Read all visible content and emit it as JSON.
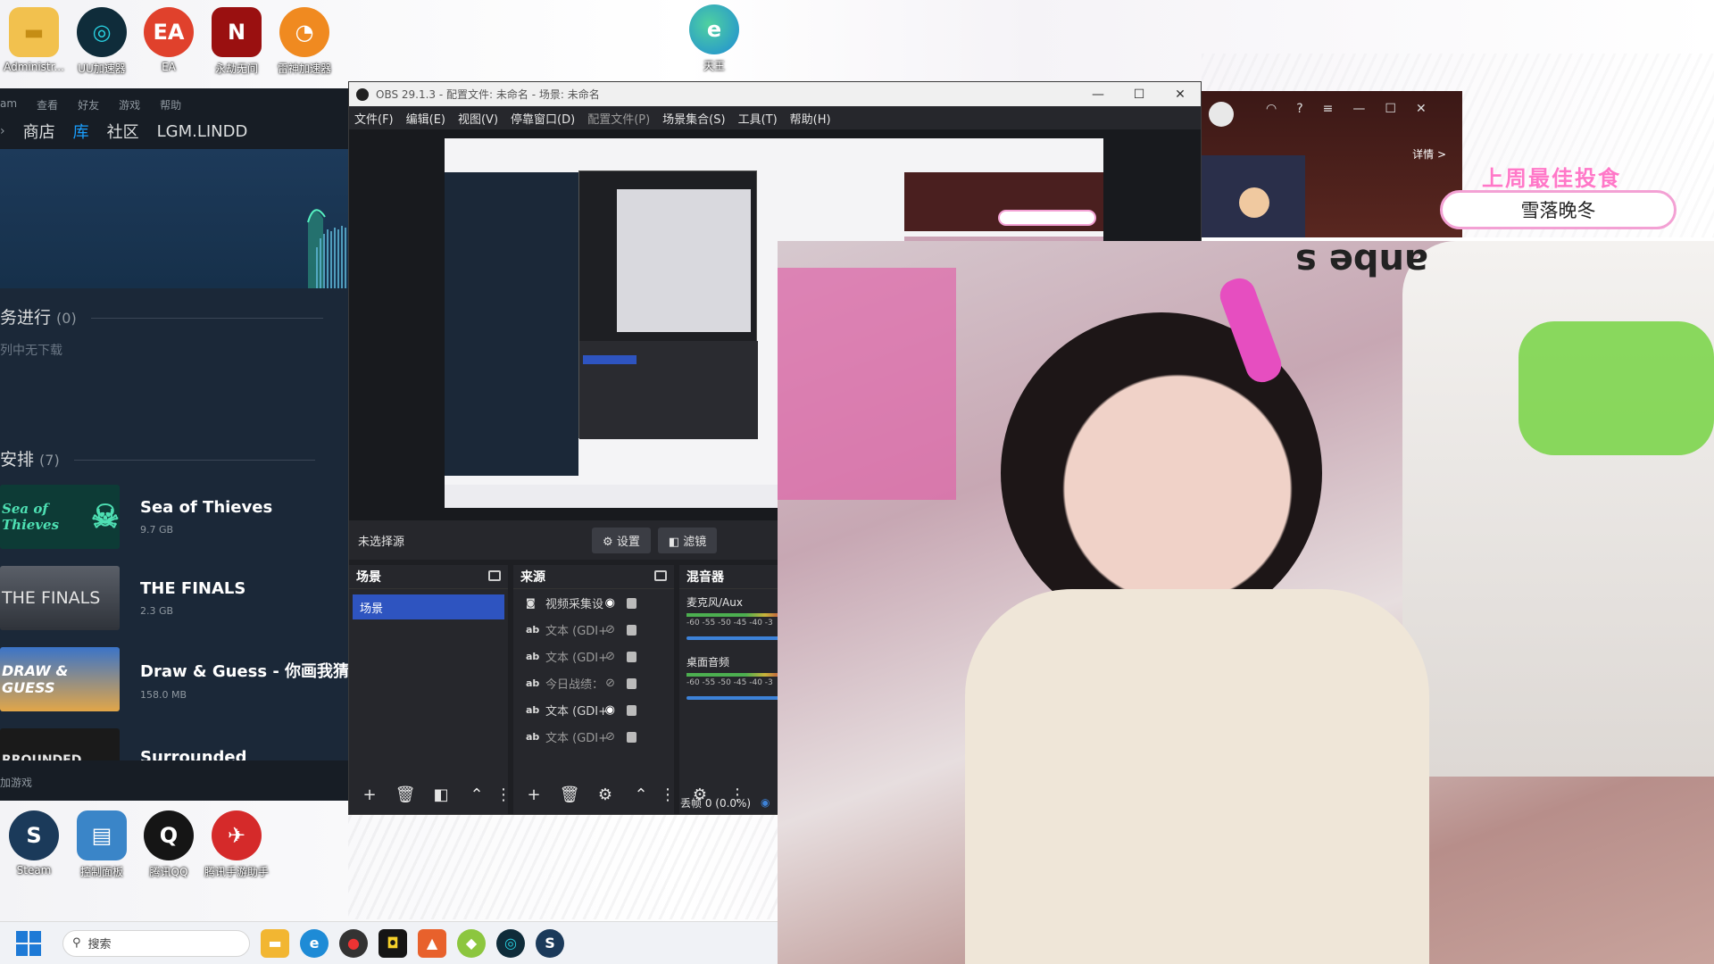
{
  "desktop": {
    "icons": [
      {
        "label": "Administr...",
        "glyph": "▬",
        "color": "#f2c14e"
      },
      {
        "label": "UU加速器",
        "glyph": "◎",
        "color": "#0f2c3a"
      },
      {
        "label": "EA",
        "glyph": "EA",
        "color": "#e0412c"
      },
      {
        "label": "永劫无间",
        "glyph": "N",
        "color": "#9a1010"
      },
      {
        "label": "雷神加速器",
        "glyph": "◔",
        "color": "#f08a20"
      }
    ],
    "edge_label": "天王",
    "bottom_icons": [
      {
        "label": "Steam",
        "glyph": "S",
        "color": "#1b3a5a"
      },
      {
        "label": "控制面板",
        "glyph": "▤",
        "color": "#3a85c8"
      },
      {
        "label": "腾讯QQ",
        "glyph": "Q",
        "color": "#151515"
      },
      {
        "label": "腾讯手游助手",
        "glyph": "✈",
        "color": "#d52a2a"
      }
    ]
  },
  "steam": {
    "menu": [
      "am",
      "查看",
      "好友",
      "游戏",
      "帮助"
    ],
    "nav": [
      "商店",
      "库",
      "社区",
      "LGM.LINDD"
    ],
    "downloading": {
      "title": "务进行",
      "count": "(0)",
      "empty_text": "列中无下载"
    },
    "scheduled": {
      "title": "安排",
      "count": "(7)"
    },
    "games": [
      {
        "name": "Sea of Thieves",
        "size": "9.7 GB",
        "art": "Sea of Thieves",
        "art_bg": "#0d3b36",
        "art_fg": "#4ee0b3"
      },
      {
        "name": "THE FINALS",
        "size": "2.3 GB",
        "art": "THE FINALS",
        "art_bg": "#3c4048",
        "art_fg": "#e4e4e4"
      },
      {
        "name": "Draw & Guess - 你画我猜",
        "size": "158.0 MB",
        "art": "DRAW & GUESS",
        "art_bg": "#2c5db0",
        "art_fg": "#fff"
      },
      {
        "name": "Surrounded",
        "size": "",
        "art": "RROUNDED",
        "art_bg": "#1a1a1a",
        "art_fg": "#e8e8e8"
      }
    ],
    "footer": "加游戏"
  },
  "obs": {
    "title": "OBS 29.1.3 - 配置文件: 未命名 - 场景: 未命名",
    "menu": [
      "文件(F)",
      "编辑(E)",
      "视图(V)",
      "停靠窗口(D)",
      "配置文件(P)",
      "场景集合(S)",
      "工具(T)",
      "帮助(H)"
    ],
    "no_source": "未选择源",
    "settings_btn": "设置",
    "filters_btn": "滤镜",
    "scenes_title": "场景",
    "scene_item": "场景",
    "sources_title": "来源",
    "sources": [
      {
        "type": "cam",
        "label": "视频采集设",
        "visible": true
      },
      {
        "type": "ab",
        "label": "文本 (GDI+",
        "visible": false
      },
      {
        "type": "ab",
        "label": "文本 (GDI+",
        "visible": false
      },
      {
        "type": "ab",
        "label": "今日战绩：",
        "visible": false
      },
      {
        "type": "ab",
        "label": "文本 (GDI+",
        "visible": true
      },
      {
        "type": "ab",
        "label": "文本 (GDI+",
        "visible": false
      }
    ],
    "mixer_title": "混音器",
    "mixer": [
      {
        "name": "麦克风/Aux",
        "ticks": "-60 -55 -50 -45 -40 -3"
      },
      {
        "name": "桌面音频",
        "ticks": "-60 -55 -50 -45 -40 -3"
      }
    ],
    "status": "丢帧 0 (0.0%)"
  },
  "overlay": {
    "pink_title": "上周最佳投食",
    "name": "雪落晚冬",
    "detail": "详情 >",
    "cam_text": "anbe s"
  },
  "taskbar": {
    "search_placeholder": "搜索",
    "apps": [
      {
        "name": "file-explorer-icon",
        "glyph": "▬",
        "color": "#f2b632"
      },
      {
        "name": "edge-icon",
        "glyph": "e",
        "color": "#1e8bd6"
      },
      {
        "name": "app-red-icon",
        "glyph": "●",
        "color": "#333"
      },
      {
        "name": "app-yellow-icon",
        "glyph": "◘",
        "color": "#151515"
      },
      {
        "name": "app-orange-icon",
        "glyph": "▲",
        "color": "#e8612c"
      },
      {
        "name": "app-green-icon",
        "glyph": "◆",
        "color": "#8cc63f"
      },
      {
        "name": "uu-icon",
        "glyph": "◎",
        "color": "#0f2c3a"
      },
      {
        "name": "steam-icon",
        "glyph": "S",
        "color": "#1b3a5a"
      }
    ]
  }
}
